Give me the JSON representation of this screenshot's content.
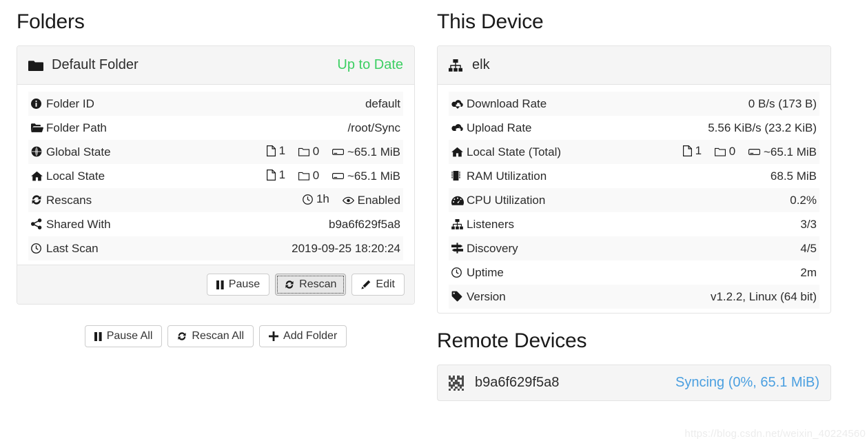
{
  "sections": {
    "folders_title": "Folders",
    "this_device_title": "This Device",
    "remote_devices_title": "Remote Devices"
  },
  "colors": {
    "success_green": "#3dcf63",
    "syncing_blue": "#4a9fe0",
    "panel_header_bg": "#f5f5f5",
    "panel_border": "#e3e3e3",
    "row_stripe": "#f9f9f9"
  },
  "folder_panel": {
    "icon": "folder-icon",
    "name": "Default Folder",
    "status": "Up to Date",
    "rows": [
      {
        "icon": "info-circle-icon",
        "label": "Folder ID",
        "value": "default"
      },
      {
        "icon": "folder-open-icon",
        "label": "Folder Path",
        "value": "/root/Sync"
      },
      {
        "icon": "globe-icon",
        "label": "Global State",
        "segments": [
          {
            "icon": "file-icon",
            "text": "1"
          },
          {
            "icon": "folder-outline-icon",
            "text": "0"
          },
          {
            "icon": "hdd-icon",
            "text": "~65.1 MiB"
          }
        ]
      },
      {
        "icon": "home-icon",
        "label": "Local State",
        "segments": [
          {
            "icon": "file-icon",
            "text": "1"
          },
          {
            "icon": "folder-outline-icon",
            "text": "0"
          },
          {
            "icon": "hdd-icon",
            "text": "~65.1 MiB"
          }
        ]
      },
      {
        "icon": "refresh-icon",
        "label": "Rescans",
        "segments": [
          {
            "icon": "clock-icon",
            "text": "1h"
          },
          {
            "icon": "eye-icon",
            "text": "Enabled"
          }
        ]
      },
      {
        "icon": "share-alt-icon",
        "label": "Shared With",
        "value": "b9a6f629f5a8"
      },
      {
        "icon": "clock-icon",
        "label": "Last Scan",
        "value": "2019-09-25 18:20:24"
      }
    ],
    "buttons": [
      {
        "icon": "pause-icon",
        "label": "Pause",
        "focused": false
      },
      {
        "icon": "refresh-icon",
        "label": "Rescan",
        "focused": true
      },
      {
        "icon": "pencil-icon",
        "label": "Edit",
        "focused": false
      }
    ]
  },
  "global_buttons": [
    {
      "icon": "pause-icon",
      "label": "Pause All"
    },
    {
      "icon": "refresh-icon",
      "label": "Rescan All"
    },
    {
      "icon": "plus-icon",
      "label": "Add Folder"
    }
  ],
  "device_panel": {
    "icon": "sitemap-icon",
    "name": "elk",
    "rows": [
      {
        "icon": "cloud-download-icon",
        "label": "Download Rate",
        "value": "0 B/s (173 B)"
      },
      {
        "icon": "cloud-upload-icon",
        "label": "Upload Rate",
        "value": "5.56 KiB/s (23.2 KiB)"
      },
      {
        "icon": "home-icon",
        "label": "Local State (Total)",
        "segments": [
          {
            "icon": "file-icon",
            "text": "1"
          },
          {
            "icon": "folder-outline-icon",
            "text": "0"
          },
          {
            "icon": "hdd-icon",
            "text": "~65.1 MiB"
          }
        ]
      },
      {
        "icon": "memory-icon",
        "label": "RAM Utilization",
        "value": "68.5 MiB"
      },
      {
        "icon": "tachometer-icon",
        "label": "CPU Utilization",
        "value": "0.2%"
      },
      {
        "icon": "sitemap-icon",
        "label": "Listeners",
        "value": "3/3",
        "value_color": "green"
      },
      {
        "icon": "map-signs-icon",
        "label": "Discovery",
        "value": "4/5"
      },
      {
        "icon": "clock-icon",
        "label": "Uptime",
        "value": "2m"
      },
      {
        "icon": "tag-icon",
        "label": "Version",
        "value": "v1.2.2, Linux (64 bit)"
      }
    ]
  },
  "remote_devices": [
    {
      "icon": "qrcode-icon",
      "name": "b9a6f629f5a8",
      "status": "Syncing (0%, 65.1 MiB)",
      "status_color": "blue"
    }
  ],
  "watermark": "https://blog.csdn.net/weixin_40224560"
}
